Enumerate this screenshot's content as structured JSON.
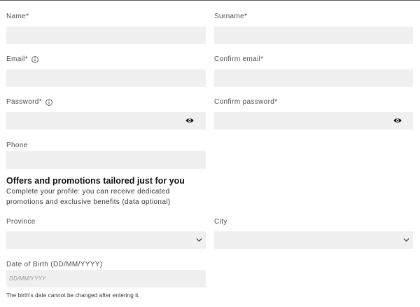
{
  "form": {
    "name": {
      "label": "Name*",
      "value": ""
    },
    "surname": {
      "label": "Surname*",
      "value": ""
    },
    "email": {
      "label": "Email*",
      "value": ""
    },
    "confirm_email": {
      "label": "Confirm email*",
      "value": ""
    },
    "password": {
      "label": "Password*",
      "value": ""
    },
    "confirm_password": {
      "label": "Confirm password*",
      "value": ""
    },
    "phone": {
      "label": "Phone",
      "value": ""
    },
    "offers": {
      "title": "Offers and promotions tailored just for you",
      "description_lines": [
        "Complete your profile: you can receive dedicated",
        "promotions and exclusive benefits (data optional)"
      ]
    },
    "province": {
      "label": "Province",
      "selected": ""
    },
    "city": {
      "label": "City",
      "selected": ""
    },
    "date_of_birth": {
      "label": "Date of Birth (DD/MM/YYYY)",
      "placeholder": "DD/MM/YYYY",
      "value": "",
      "note": "The birth's date cannot be changed after entering it."
    }
  },
  "icons": {
    "info": "info-icon",
    "password_visibility": "eye-icon",
    "select_caret": "chevron-down-icon"
  },
  "colors": {
    "input_background": "#f0f0f0",
    "label_text": "#4d4d4d",
    "heading_text": "#111111",
    "placeholder_text": "#9a9a9a",
    "top_border": "#5a5a5a"
  }
}
